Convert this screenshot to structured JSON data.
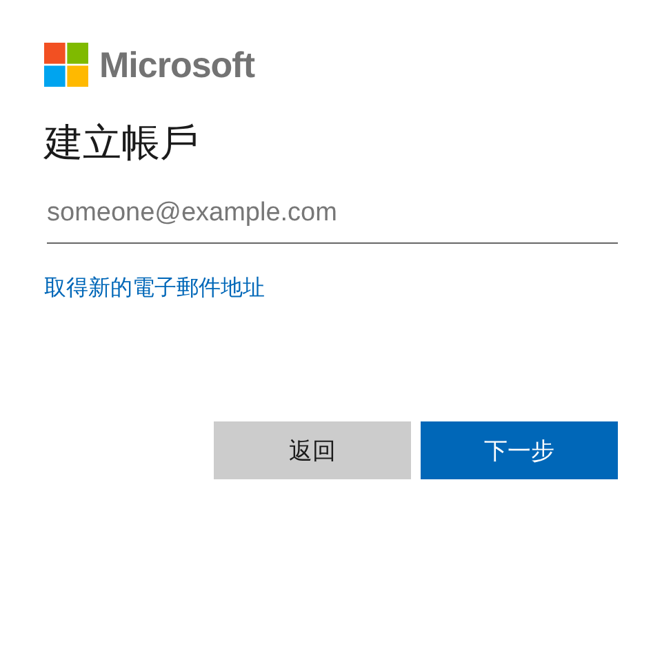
{
  "brand": {
    "name": "Microsoft"
  },
  "title": "建立帳戶",
  "email_field": {
    "placeholder": "someone@example.com"
  },
  "link": "取得新的電子郵件地址",
  "buttons": [
    {
      "label": "返回",
      "kind": "secondary"
    },
    {
      "label": "下一步",
      "kind": "primary"
    }
  ]
}
